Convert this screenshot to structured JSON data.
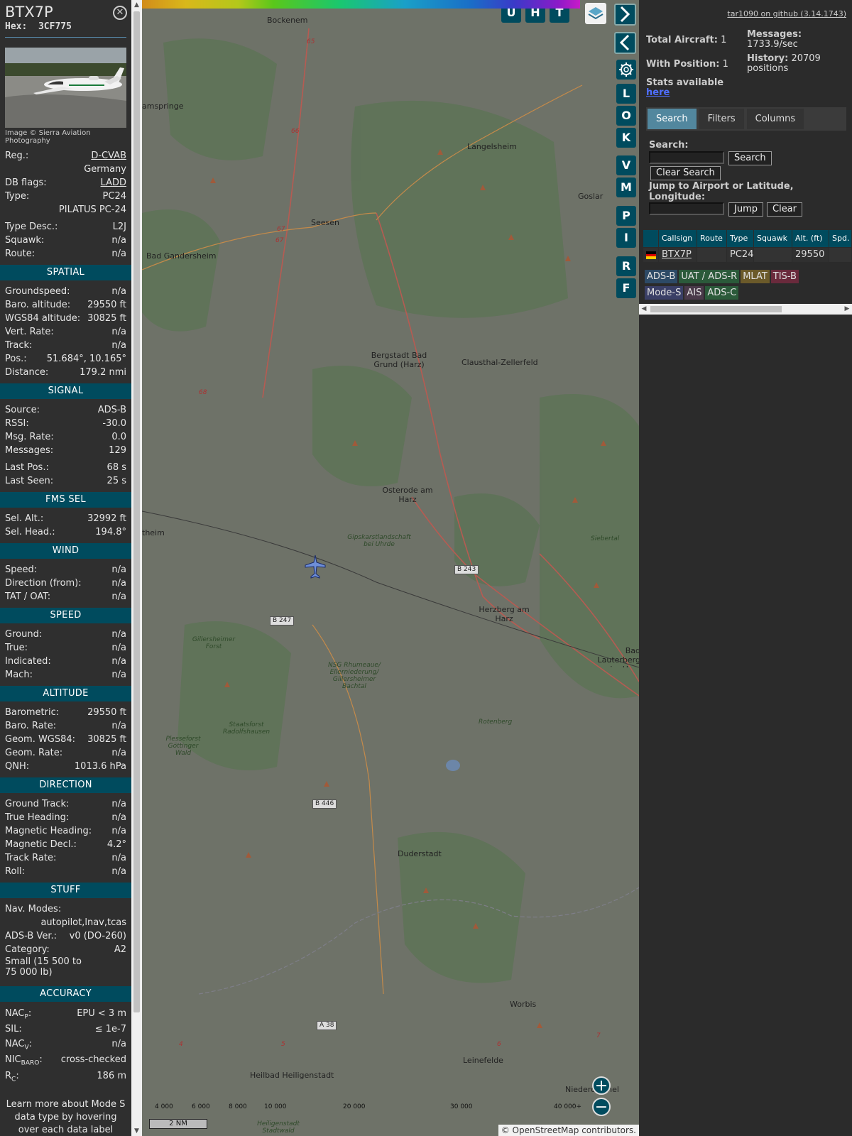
{
  "sidebar": {
    "callsign": "BTX7P",
    "hex_label": "Hex:",
    "hex": "3CF775",
    "close_symbol": "✕",
    "photo_credit": "Image © Sierra Aviation Photography",
    "reg_label": "Reg.:",
    "reg": "D-CVAB",
    "country": "Germany",
    "dbflags_label": "DB flags:",
    "dbflags": "LADD",
    "type_label": "Type:",
    "type": "PC24",
    "type_name": "PILATUS PC-24",
    "typedesc_label": "Type Desc.:",
    "typedesc": "L2J",
    "squawk_label": "Squawk:",
    "squawk": "n/a",
    "route_label": "Route:",
    "route": "n/a",
    "spatial": {
      "title": "SPATIAL",
      "groundspeed_label": "Groundspeed:",
      "groundspeed": "n/a",
      "baro_label": "Baro. altitude:",
      "baro": "29550 ft",
      "wgs_label": "WGS84 altitude:",
      "wgs": "30825 ft",
      "vert_label": "Vert. Rate:",
      "vert": "n/a",
      "track_label": "Track:",
      "track": "n/a",
      "pos_label": "Pos.:",
      "pos": "51.684°, 10.165°",
      "dist_label": "Distance:",
      "dist": "179.2 nmi"
    },
    "signal": {
      "title": "SIGNAL",
      "source_label": "Source:",
      "source": "ADS-B",
      "rssi_label": "RSSI:",
      "rssi": "-30.0",
      "msgrate_label": "Msg. Rate:",
      "msgrate": "0.0",
      "messages_label": "Messages:",
      "messages": "129",
      "lastpos_label": "Last Pos.:",
      "lastpos": "68 s",
      "lastseen_label": "Last Seen:",
      "lastseen": "25 s"
    },
    "fms": {
      "title": "FMS SEL",
      "selalt_label": "Sel. Alt.:",
      "selalt": "32992 ft",
      "selhead_label": "Sel. Head.:",
      "selhead": "194.8°"
    },
    "wind": {
      "title": "WIND",
      "speed_label": "Speed:",
      "speed": "n/a",
      "dir_label": "Direction (from):",
      "dir": "n/a",
      "tat_label": "TAT / OAT:",
      "tat": "n/a"
    },
    "speed": {
      "title": "SPEED",
      "ground_label": "Ground:",
      "ground": "n/a",
      "true_label": "True:",
      "true": "n/a",
      "ind_label": "Indicated:",
      "ind": "n/a",
      "mach_label": "Mach:",
      "mach": "n/a"
    },
    "altitude": {
      "title": "ALTITUDE",
      "baro_label": "Barometric:",
      "baro": "29550 ft",
      "barorate_label": "Baro. Rate:",
      "barorate": "n/a",
      "geom_label": "Geom. WGS84:",
      "geom": "30825 ft",
      "geomrate_label": "Geom. Rate:",
      "geomrate": "n/a",
      "qnh_label": "QNH:",
      "qnh": "1013.6 hPa"
    },
    "direction": {
      "title": "DIRECTION",
      "gt_label": "Ground Track:",
      "gt": "n/a",
      "th_label": "True Heading:",
      "th": "n/a",
      "mh_label": "Magnetic Heading:",
      "mh": "n/a",
      "md_label": "Magnetic Decl.:",
      "md": "4.2°",
      "tr_label": "Track Rate:",
      "tr": "n/a",
      "roll_label": "Roll:",
      "roll": "n/a"
    },
    "stuff": {
      "title": "STUFF",
      "nav_label": "Nav. Modes:",
      "nav": "autopilot,lnav,tcas",
      "adsb_label": "ADS-B Ver.:",
      "adsb": "v0 (DO-260)",
      "cat_label": "Category:",
      "cat": "A2",
      "cat_desc": "Small (15 500 to 75 000 lb)"
    },
    "accuracy": {
      "title": "ACCURACY",
      "nacp_label": "NAC",
      "nacp_sub": "P",
      "nacp": "EPU < 3 m",
      "sil_label": "SIL:",
      "sil": "≤ 1e-7",
      "nacv_label": "NAC",
      "nacv_sub": "V",
      "nacv": "n/a",
      "nic_label": "NIC",
      "nic_sub": "BARO",
      "nic": "cross-checked",
      "rc_label": "R",
      "rc_sub": "C",
      "rc": "186 m"
    },
    "footer": "Learn more about Mode S data type by hovering over each data label"
  },
  "map": {
    "buttons": [
      "U",
      "H",
      "T"
    ],
    "side_buttons": [
      "L",
      "O",
      "K",
      "V",
      "M",
      "P",
      "I",
      "R",
      "F"
    ],
    "places": [
      "Bockenem",
      "amspringe",
      "Langelsheim",
      "Goslar",
      "Seesen",
      "Bad Gandersheim",
      "Bergstadt Bad Grund (Harz)",
      "Clausthal-Zellerfeld",
      "Osterode am Harz",
      "theim",
      "Herzberg am Harz",
      "Bad Lauterberg im Harz",
      "Duderstadt",
      "Worbis",
      "Leinefelde",
      "Heilbad Heiligenstadt",
      "Niederorschel"
    ],
    "nature": [
      "Gipskarstlandschaft bei Uhrde",
      "Siebertal",
      "Gillersheimer Forst",
      "NSG Rhumeaue/ Ellerniederung/ Gillersheimer Bachtal",
      "Staatsforst Radolfshausen",
      "Plesseforst Göttinger Wald",
      "Rotenberg",
      "Heiligenstadt Stadtwald"
    ],
    "roads": [
      "B 243",
      "B 247",
      "B 446",
      "A 38"
    ],
    "road_numbers": [
      "65",
      "66",
      "67",
      "67",
      "68",
      "4",
      "5",
      "6",
      "7"
    ],
    "colorbar_ticks": [
      "4 000",
      "6 000",
      "8 000",
      "10 000",
      "20 000",
      "30 000",
      "40 000+"
    ],
    "colorbar_colors": [
      "#d28c1a",
      "#d9b81a",
      "#b4c81a",
      "#5ac81a",
      "#1ac86e",
      "#1aa0c8",
      "#1a6ec8",
      "#3a3ac8",
      "#8c1ac8",
      "#c81ac8"
    ],
    "scale": "2 NM",
    "attribution_prefix": "© ",
    "attribution_link": "OpenStreetMap",
    "attribution_suffix": " contributors.",
    "zoom_in": "+",
    "zoom_out": "−"
  },
  "panel": {
    "version": "tar1090 on github (3.14.1743)",
    "total_label": "Total Aircraft:",
    "total": "1",
    "withpos_label": "With Position:",
    "withpos": "1",
    "stats_label": "Stats available",
    "stats_link": "here",
    "messages_label": "Messages:",
    "messages": "1733.9/sec",
    "history_label": "History:",
    "history": "20709 positions",
    "tabs": [
      "Search",
      "Filters",
      "Columns"
    ],
    "search_label": "Search:",
    "search_button": "Search",
    "clear_search_button": "Clear Search",
    "jump_label": "Jump to Airport or Latitude, Longitude:",
    "jump_button": "Jump",
    "clear_button": "Clear",
    "table": {
      "headers": [
        "",
        "Callsign",
        "Route",
        "Type",
        "Squawk",
        "Alt. (ft)",
        "Spd."
      ],
      "rows": [
        {
          "callsign": "BTX7P",
          "route": "",
          "type": "PC24",
          "squawk": "",
          "alt": "29550",
          "spd": ""
        }
      ]
    },
    "badges": [
      {
        "label": "ADS-B",
        "bg": "#2d4a66",
        "fg": "#e0e0e0"
      },
      {
        "label": "UAT / ADS-R",
        "bg": "#2b5a3a",
        "fg": "#e0e0e0"
      },
      {
        "label": "MLAT",
        "bg": "#6b5a2a",
        "fg": "#e0e0e0"
      },
      {
        "label": "TIS-B",
        "bg": "#6a2a3c",
        "fg": "#e0e0e0"
      },
      {
        "label": "Mode-S",
        "bg": "#3a3f66",
        "fg": "#e0e0e0"
      },
      {
        "label": "AIS",
        "bg": "#4a3a4a",
        "fg": "#e0e0e0"
      },
      {
        "label": "ADS-C",
        "bg": "#2b5a3a",
        "fg": "#e0e0e0"
      }
    ]
  },
  "colors": {
    "accent": "#004b5e",
    "active_tab": "#52879e",
    "map_bg": "#6e7268"
  }
}
